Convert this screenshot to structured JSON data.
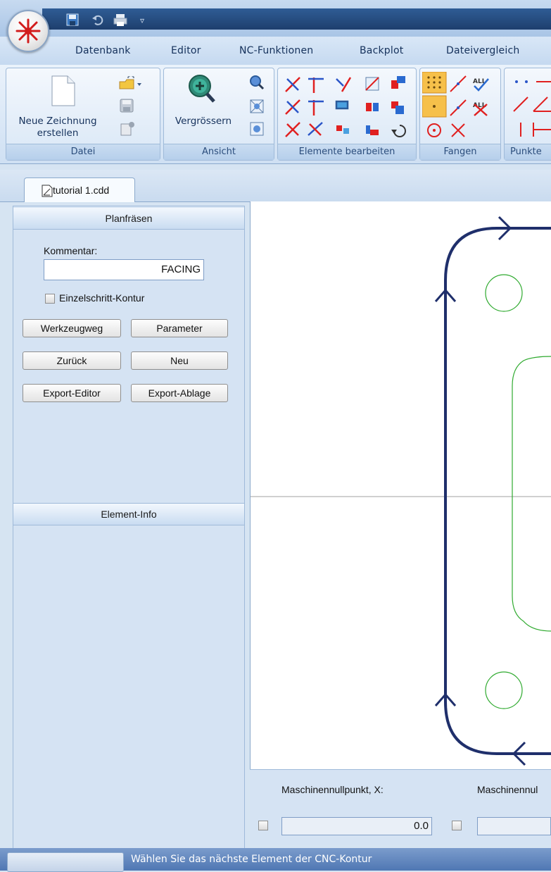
{
  "menu": {
    "tabs": [
      "Datenbank",
      "Editor",
      "NC-Funktionen",
      "Backplot",
      "Dateivergleich"
    ]
  },
  "ribbon": {
    "groups": {
      "datei": {
        "label": "Datei",
        "new_drawing_line1": "Neue Zeichnung",
        "new_drawing_line2": "erstellen"
      },
      "ansicht": {
        "label": "Ansicht",
        "zoom_label": "Vergrössern"
      },
      "elemente": {
        "label": "Elemente bearbeiten"
      },
      "fangen": {
        "label": "Fangen",
        "all_label": "ALL"
      },
      "punkte": {
        "label": "Punkte"
      }
    }
  },
  "document_tab": {
    "label": "tutorial 1.cdd"
  },
  "planfraesen_panel": {
    "title": "Planfräsen",
    "comment_label": "Kommentar:",
    "comment_value": "FACING",
    "single_step_label": "Einzelschritt-Kontur",
    "buttons": {
      "toolpath": "Werkzeugweg",
      "parameter": "Parameter",
      "back": "Zurück",
      "new": "Neu",
      "export_editor": "Export-Editor",
      "export_storage": "Export-Ablage"
    }
  },
  "element_info_panel": {
    "title": "Element-Info"
  },
  "fields": {
    "machine_zero_x_label": "Maschinennullpunkt, X:",
    "machine_zero_x_value": "0.0",
    "machine_zero_y_label": "Maschinennul"
  },
  "status": {
    "message": "Wählen Sie das nächste Element der CNC-Kontur"
  },
  "colors": {
    "toolpath": "#1f2f6b",
    "part_contour": "#2faa2f",
    "accent": "#1e3f6d"
  }
}
